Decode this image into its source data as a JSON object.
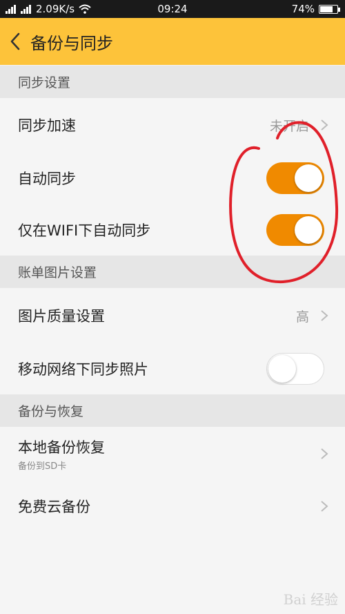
{
  "status_bar": {
    "network_speed": "2.09K/s",
    "time": "09:24",
    "battery_percent": "74%",
    "battery_level": 0.74
  },
  "header": {
    "title": "备份与同步"
  },
  "sections": {
    "sync": {
      "header": "同步设置",
      "sync_speed": {
        "label": "同步加速",
        "value": "未开启"
      },
      "auto_sync": {
        "label": "自动同步",
        "state": "on"
      },
      "wifi_only": {
        "label": "仅在WIFI下自动同步",
        "state": "on"
      }
    },
    "image": {
      "header": "账单图片设置",
      "quality": {
        "label": "图片质量设置",
        "value": "高"
      },
      "mobile_sync": {
        "label": "移动网络下同步照片",
        "state": "off"
      }
    },
    "backup": {
      "header": "备份与恢复",
      "local": {
        "label": "本地备份恢复",
        "sublabel": "备份到SD卡"
      },
      "cloud": {
        "label": "免费云备份"
      }
    }
  },
  "colors": {
    "app_bar": "#fdc33a",
    "toggle_on": "#f08a00",
    "annotation": "#e0202a"
  },
  "watermark": "Bai 经验"
}
